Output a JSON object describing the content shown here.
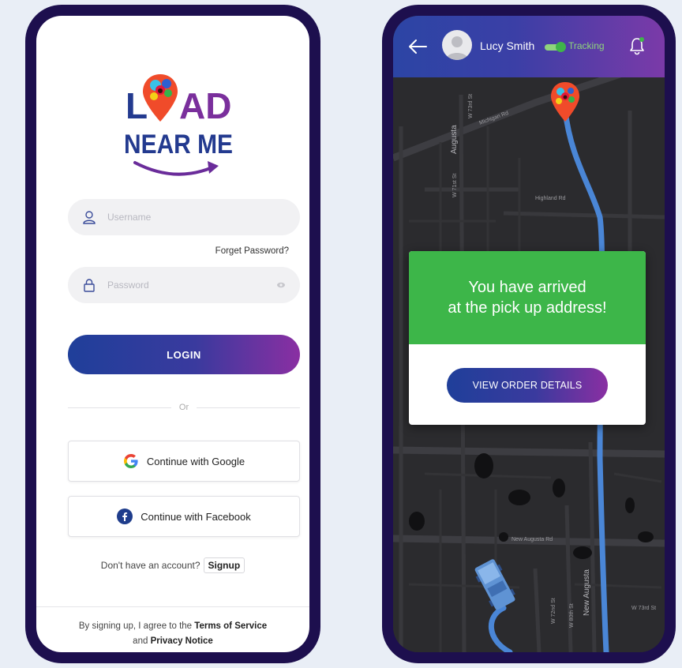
{
  "login_screen": {
    "username_placeholder": "Username",
    "forgot_password": "Forget Password?",
    "password_placeholder": "Password",
    "login_label": "LOGIN",
    "or_label": "Or",
    "google_label": "Continue with Google",
    "facebook_label": "Continue with Facebook",
    "no_account_text": "Don't have an account?",
    "signup_label": "Signup",
    "terms_prefix": "By signing up, I agree to the",
    "terms_link": "Terms of Service",
    "terms_and": "and",
    "privacy_link": "Privacy Notice"
  },
  "logo": {
    "line1": "LOAD",
    "line2": "NEAR ME",
    "colors": {
      "navy": "#233a8f",
      "purple": "#7a2f9c",
      "arrow": "#6a2c9a"
    }
  },
  "tracking_screen": {
    "user_name": "Lucy Smith",
    "tracking_label": "Tracking",
    "tracking_on": true,
    "arrival_line1": "You have arrived",
    "arrival_line2": "at the pick up address!",
    "view_order_label": "VIEW ORDER DETAILS",
    "map_labels": {
      "augusta": "Augusta",
      "michigan_rd": "Michigan Rd",
      "highland_rd": "Highland Rd",
      "new_augusta_rd": "New Augusta Rd",
      "new_augusta": "New Augusta",
      "w_73rd": "W 73rd St",
      "w_71st": "W 71st St",
      "w_80th": "W 80th St",
      "w_72nd": "W 72nd St",
      "w_73rd_e": "W 73rd St"
    }
  },
  "colors": {
    "frame": "#1d0f4e",
    "gradient_start": "#1f3f9a",
    "gradient_end": "#8a2fa2",
    "arrival_green": "#3db649",
    "route_blue": "#4a86d6",
    "map_bg": "#2b2b2e"
  }
}
